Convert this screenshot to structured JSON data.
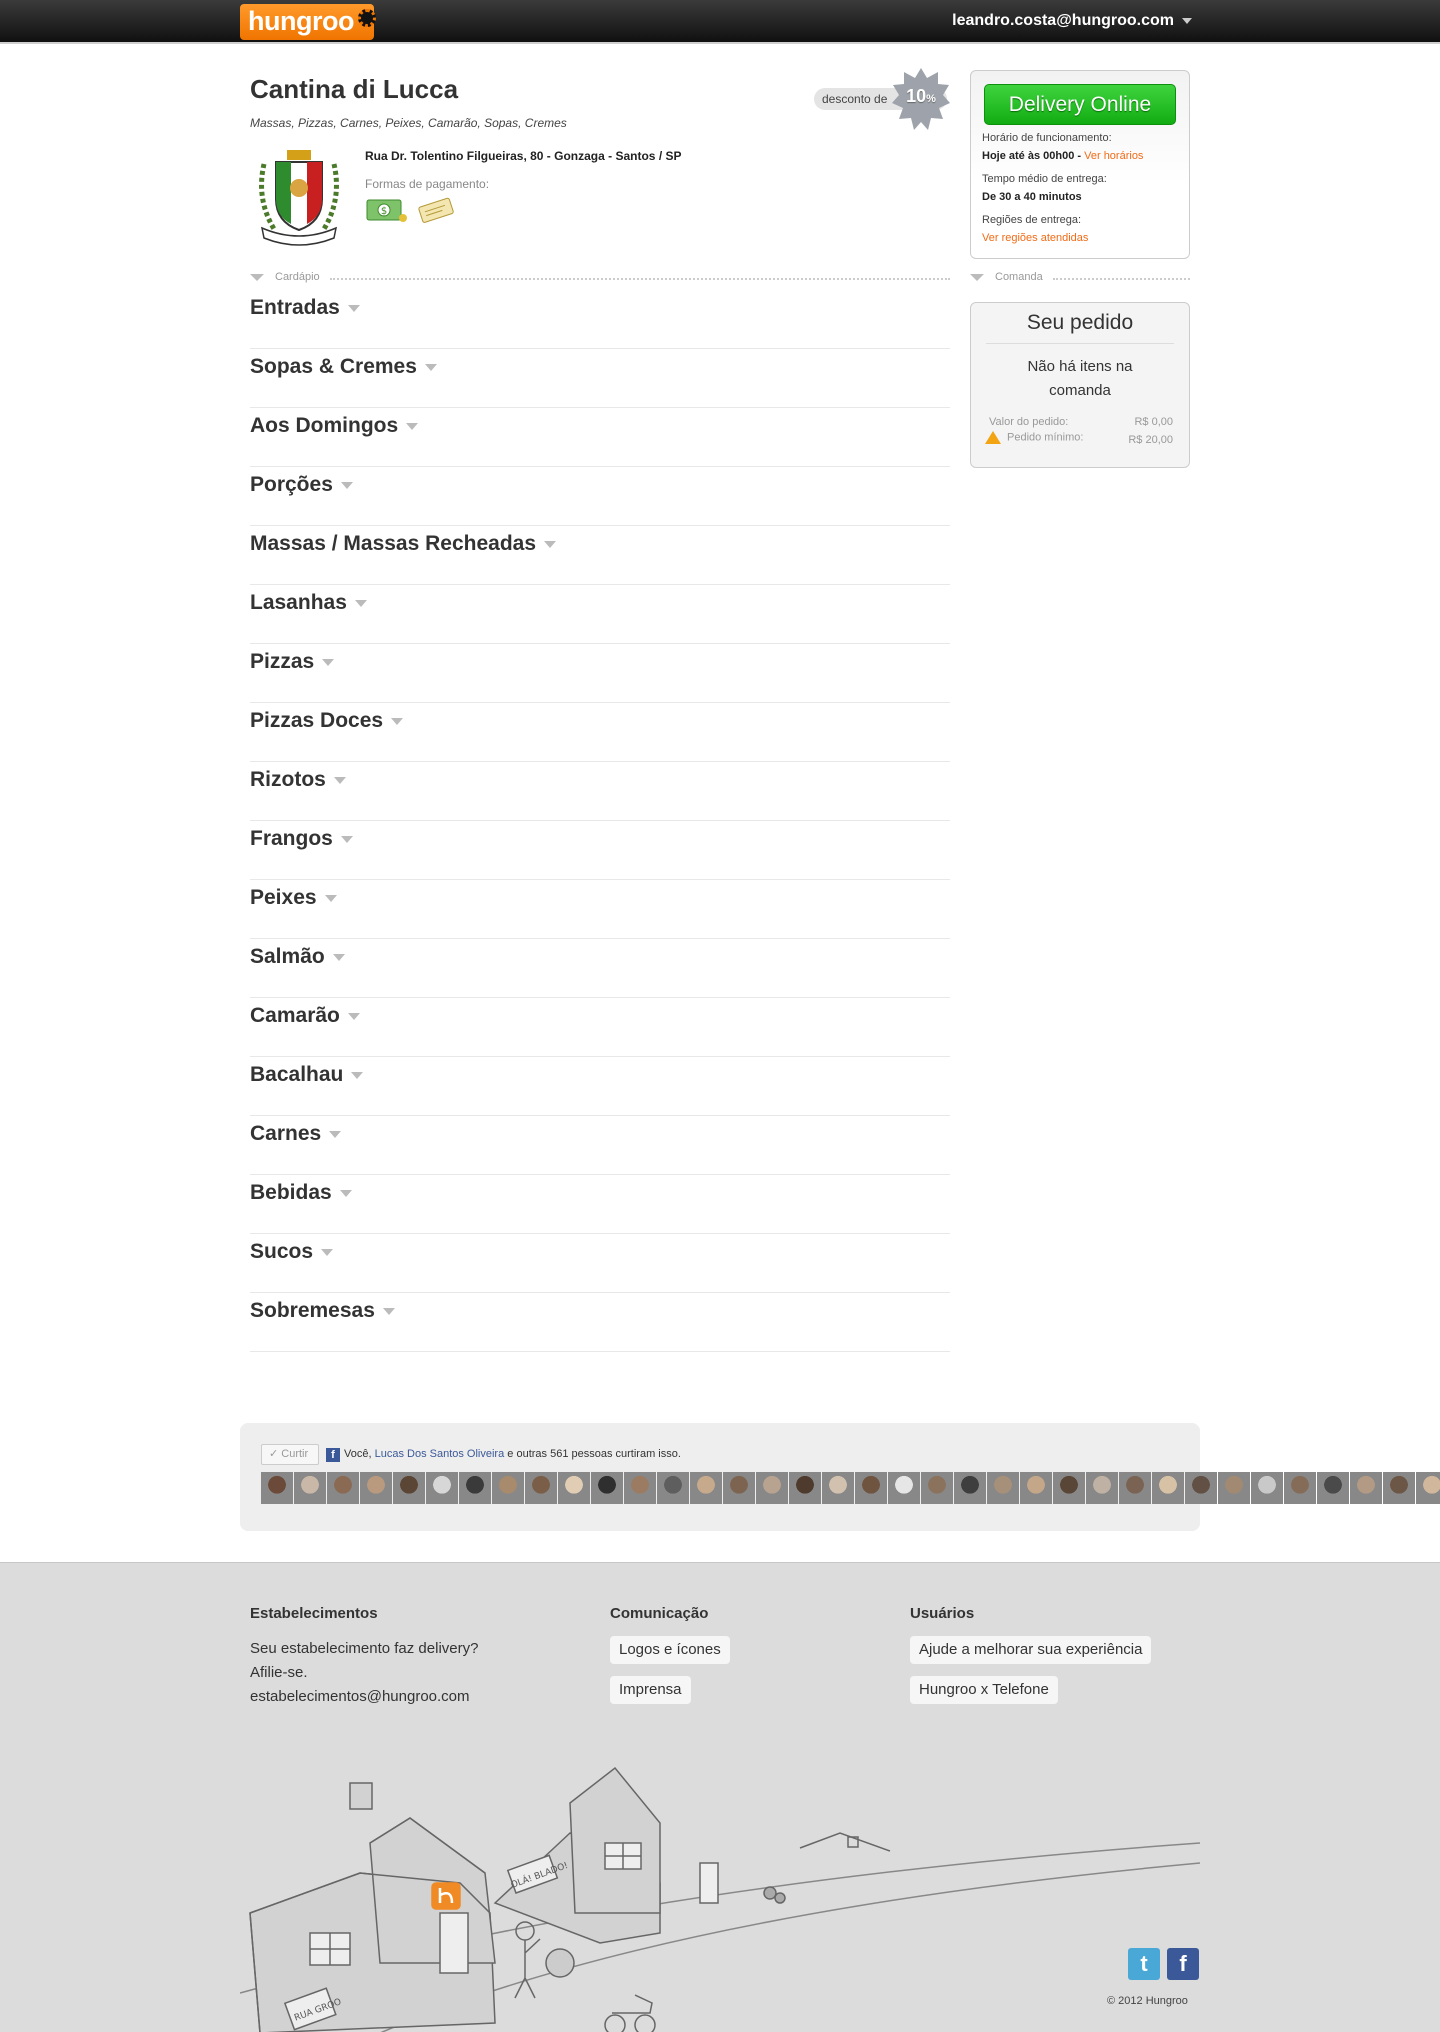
{
  "topbar": {
    "logo_text": "hungroo",
    "user_email": "leandro.costa@hungroo.com"
  },
  "restaurant": {
    "name": "Cantina di Lucca",
    "categories": "Massas, Pizzas, Carnes, Peixes, Camarão, Sopas, Cremes",
    "address": "Rua Dr. Tolentino Filgueiras, 80 - Gonzaga - Santos / SP",
    "payment_label": "Formas de pagamento:",
    "payment_icons": [
      "cash-icon",
      "voucher-icon"
    ],
    "crest_text": "Cantina di Lucca",
    "discount_label": "desconto de",
    "discount_value": "10",
    "discount_unit": "%"
  },
  "sidebar": {
    "delivery_button": "Delivery Online",
    "hours_label": "Horário de funcionamento:",
    "hours_value": "Hoje até às 00h00",
    "hours_link": "Ver horários",
    "delivery_time_label": "Tempo médio de entrega:",
    "delivery_time_value": "De 30 a 40 minutos",
    "regions_label": "Regiões de entrega:",
    "regions_link": "Ver regiões atendidas",
    "section_label": "Comanda"
  },
  "order": {
    "title": "Seu pedido",
    "empty_message": "Não há itens na comanda",
    "value_label": "Valor do pedido:",
    "value": "R$ 0,00",
    "minimum_label": "Pedido mínimo:",
    "minimum_value": "R$ 20,00"
  },
  "menu": {
    "section_label": "Cardápio",
    "categories": [
      "Entradas",
      "Sopas & Cremes",
      "Aos Domingos",
      "Porções",
      "Massas / Massas Recheadas",
      "Lasanhas",
      "Pizzas",
      "Pizzas Doces",
      "Rizotos",
      "Frangos",
      "Peixes",
      "Salmão",
      "Camarão",
      "Bacalhau",
      "Carnes",
      "Bebidas",
      "Sucos",
      "Sobremesas"
    ]
  },
  "facebook": {
    "like_button": "Curtir",
    "text_prefix": "Você,",
    "friend_name": "Lucas Dos Santos Oliveira",
    "text_suffix": "e outras 561 pessoas curtiram isso.",
    "face_colors": [
      "#6b4a3a",
      "#c9b7a8",
      "#8a6a52",
      "#b99a7e",
      "#5b4636",
      "#d7d7d7",
      "#3a3a3a",
      "#a88a6c",
      "#7a5e48",
      "#e0cdb4",
      "#2f2f2f",
      "#9b7b61",
      "#5e5e5e",
      "#c7a98c",
      "#7d6450",
      "#b8a290",
      "#4e3b2e",
      "#d2c1ae",
      "#6f5440",
      "#e6e6e6",
      "#8b725d",
      "#3e3e3e",
      "#a7907a",
      "#c4a688",
      "#594637",
      "#bfb1a3",
      "#7a6353",
      "#d8c2a6",
      "#615043",
      "#a28a72",
      "#c9c9c9",
      "#856c59",
      "#4a4a4a",
      "#b39a84",
      "#6c5747",
      "#d1b79b"
    ]
  },
  "footer": {
    "col1_title": "Estabelecimentos",
    "col1_text": "Seu estabelecimento faz delivery?",
    "col1_text2": "Afilie-se.",
    "col1_email": "estabelecimentos@hungroo.com",
    "col2_title": "Comunicação",
    "col2_links": [
      "Logos e ícones",
      "Imprensa"
    ],
    "col3_title": "Usuários",
    "col3_links": [
      "Ajude a melhorar sua experiência",
      "Hungroo x Telefone"
    ],
    "sign_text": "RUA GROO",
    "speech_text": "OLÁ! BLADO!",
    "twitter_glyph": "t",
    "facebook_glyph": "f",
    "copyright": "© 2012 Hungroo"
  }
}
